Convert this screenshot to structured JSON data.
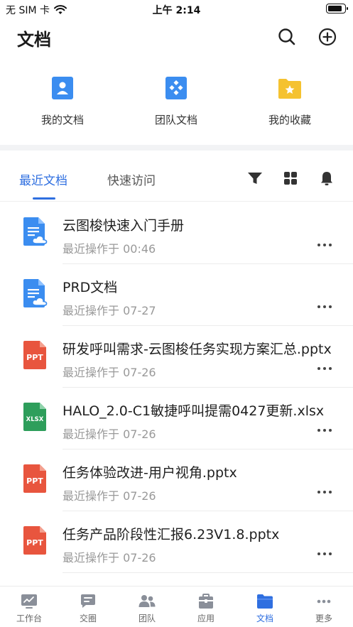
{
  "status_bar": {
    "carrier": "无 SIM 卡",
    "time": "上午 2:14",
    "battery_level": 0.9
  },
  "header": {
    "title": "文档",
    "search_icon": "search-icon",
    "add_icon": "plus-circle-icon"
  },
  "quick_access": [
    {
      "label": "我的文档",
      "icon": "my-docs-icon",
      "color": "#3b8df0"
    },
    {
      "label": "团队文档",
      "icon": "team-docs-icon",
      "color": "#3b8df0"
    },
    {
      "label": "我的收藏",
      "icon": "favorites-folder-icon",
      "color": "#f5c230"
    }
  ],
  "tabs": {
    "recent": "最近文档",
    "quick": "快速访问",
    "active_color": "#2f6fe0"
  },
  "toolbar": {
    "filter_icon": "filter-icon",
    "grid_icon": "grid-view-icon",
    "bell_icon": "bell-icon"
  },
  "files": [
    {
      "name": "云图梭快速入门手册",
      "meta": "最近操作于 00:46",
      "type": "cloud-doc"
    },
    {
      "name": "PRD文档",
      "meta": "最近操作于 07-27",
      "type": "cloud-doc"
    },
    {
      "name": "研发呼叫需求-云图梭任务实现方案汇总.pptx",
      "meta": "最近操作于 07-26",
      "type": "ppt"
    },
    {
      "name": "HALO_2.0-C1敏捷呼叫提需0427更新.xlsx",
      "meta": "最近操作于 07-26",
      "type": "xlsx"
    },
    {
      "name": "任务体验改进-用户视角.pptx",
      "meta": "最近操作于 07-26",
      "type": "ppt"
    },
    {
      "name": "任务产品阶段性汇报6.23V1.8.pptx",
      "meta": "最近操作于 07-26",
      "type": "ppt"
    }
  ],
  "file_type_labels": {
    "ppt": "PPT",
    "xlsx": "XLSX"
  },
  "bottom_nav": [
    {
      "label": "工作台",
      "icon": "dashboard-icon",
      "active": false
    },
    {
      "label": "交圈",
      "icon": "chat-icon",
      "active": false
    },
    {
      "label": "团队",
      "icon": "team-icon",
      "active": false
    },
    {
      "label": "应用",
      "icon": "apps-box-icon",
      "active": false
    },
    {
      "label": "文档",
      "icon": "docs-folder-icon",
      "active": true
    },
    {
      "label": "更多",
      "icon": "more-dots-icon",
      "active": false
    }
  ],
  "colors": {
    "accent": "#2f6fe0",
    "doc_blue": "#3b8df0",
    "ppt_red": "#e8553e",
    "xlsx_green": "#2e9e5b",
    "folder_yellow": "#f5c230"
  }
}
